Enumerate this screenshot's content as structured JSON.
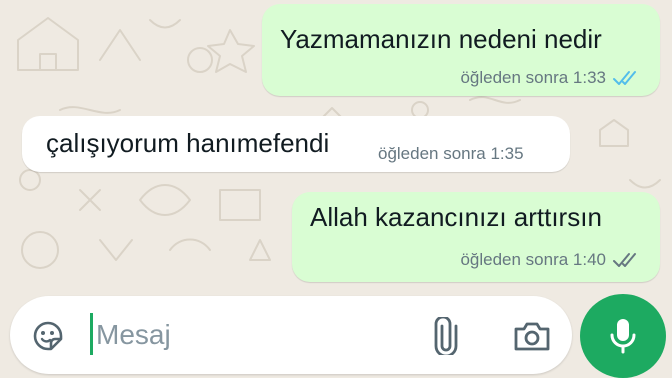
{
  "colors": {
    "outgoing_bubble": "#d9fdd3",
    "incoming_bubble": "#ffffff",
    "read_ticks": "#53bdeb",
    "delivered_ticks": "#667781",
    "accent": "#1daa61"
  },
  "messages": [
    {
      "direction": "outgoing",
      "text": "Yazmamanızın nedeni nedir",
      "time": "öğleden sonra 1:33",
      "status": "read"
    },
    {
      "direction": "incoming",
      "text": "çalışıyorum hanımefendi",
      "time": "öğleden sonra 1:35"
    },
    {
      "direction": "outgoing",
      "text": "Allah kazancınızı arttırsın",
      "time": "öğleden sonra 1:40",
      "status": "delivered"
    }
  ],
  "composer": {
    "placeholder": "Mesaj",
    "icons": [
      "sticker-icon",
      "attach-icon",
      "camera-icon",
      "mic-icon"
    ]
  }
}
